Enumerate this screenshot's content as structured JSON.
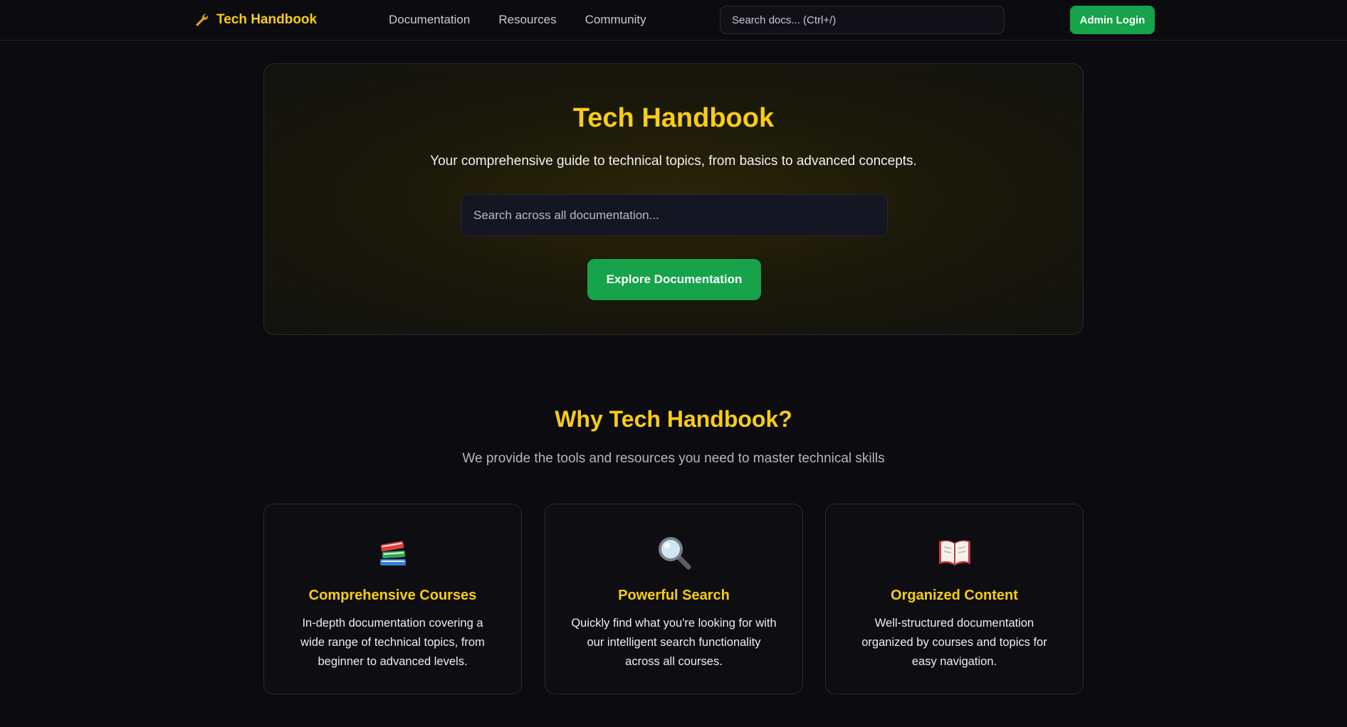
{
  "header": {
    "brand": "Tech Handbook",
    "nav": [
      "Documentation",
      "Resources",
      "Community"
    ],
    "search_placeholder": "Search docs... (Ctrl+/)",
    "admin_label": "Admin Login"
  },
  "hero": {
    "title": "Tech Handbook",
    "subtitle": "Your comprehensive guide to technical topics, from basics to advanced concepts.",
    "search_placeholder": "Search across all documentation...",
    "cta_label": "Explore Documentation"
  },
  "why": {
    "title": "Why Tech Handbook?",
    "subtitle": "We provide the tools and resources you need to master technical skills",
    "cards": [
      {
        "icon": "books-icon",
        "title": "Comprehensive Courses",
        "description": "In-depth documentation covering a wide range of technical topics, from beginner to advanced levels."
      },
      {
        "icon": "magnifier-icon",
        "title": "Powerful Search",
        "description": "Quickly find what you're looking for with our intelligent search functionality across all courses."
      },
      {
        "icon": "open-book-icon",
        "title": "Organized Content",
        "description": "Well-structured documentation organized by courses and topics for easy navigation."
      }
    ]
  },
  "colors": {
    "accent": "#facc15",
    "button": "#16a34a",
    "background": "#0b0b10"
  }
}
